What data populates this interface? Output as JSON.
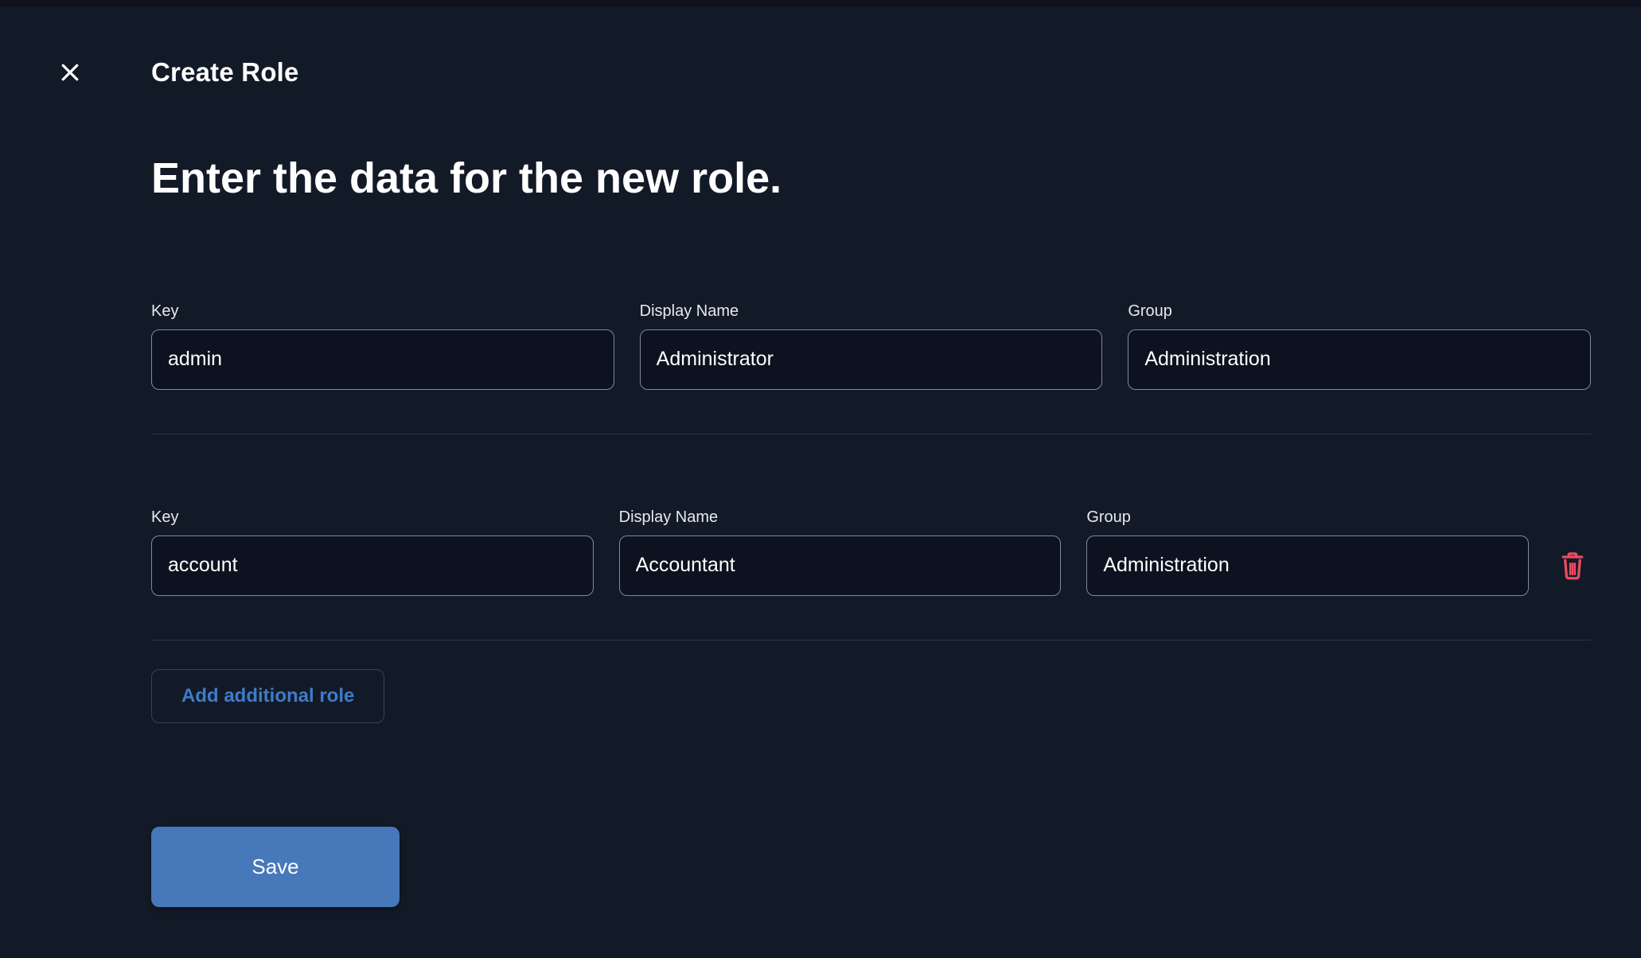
{
  "header": {
    "title": "Create Role"
  },
  "main": {
    "heading": "Enter the data for the new role."
  },
  "form": {
    "rows": [
      {
        "key": {
          "label": "Key",
          "value": "admin"
        },
        "display_name": {
          "label": "Display Name",
          "value": "Administrator"
        },
        "group": {
          "label": "Group",
          "value": "Administration"
        }
      },
      {
        "key": {
          "label": "Key",
          "value": "account"
        },
        "display_name": {
          "label": "Display Name",
          "value": "Accountant"
        },
        "group": {
          "label": "Group",
          "value": "Administration"
        }
      }
    ],
    "add_role_label": "Add additional role",
    "save_label": "Save"
  },
  "icons": {
    "close": "✕",
    "delete": "trash-can"
  },
  "colors": {
    "background": "#131a27",
    "input_background": "#0c121f",
    "input_border": "#828a97",
    "divider": "#2c3340",
    "primary_blue": "#4678ba",
    "link_blue": "#3e7cc9",
    "danger_red": "#ed4b63",
    "text_primary": "#ffffff",
    "label_text": "#e6e9ee"
  }
}
